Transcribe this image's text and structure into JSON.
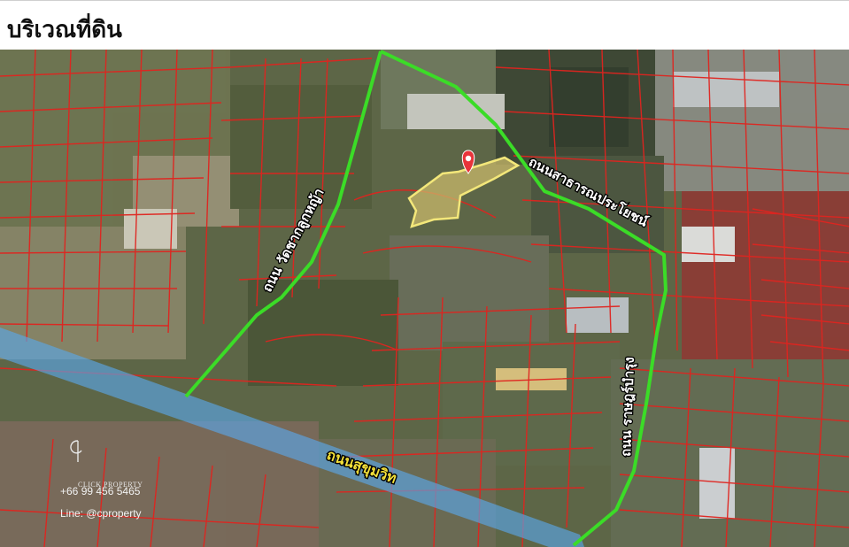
{
  "header": {
    "title": "บริเวณที่ดิน"
  },
  "map": {
    "roads": {
      "left_road": "ถนน วัดชากลูกหญ้า",
      "top_road": "ถนนสาธารณประโยชน์",
      "right_road": "ถนน ราษฎร์บำรุง",
      "highway": "ถนนสุขุมวิท"
    },
    "colors": {
      "road_route": "#3bdc27",
      "parcel_lines": "#e0241f",
      "highway_band": "#5aa6e6",
      "plot_outline": "#f3e77a",
      "plot_fill": "#c8b86a",
      "pin": "#e8343a"
    },
    "marker_icon": "location-pin-icon"
  },
  "watermark": {
    "brand": "CLICK PROPERTY",
    "phone": "+66 99 456 5465",
    "line": "Line: @cproperty"
  }
}
